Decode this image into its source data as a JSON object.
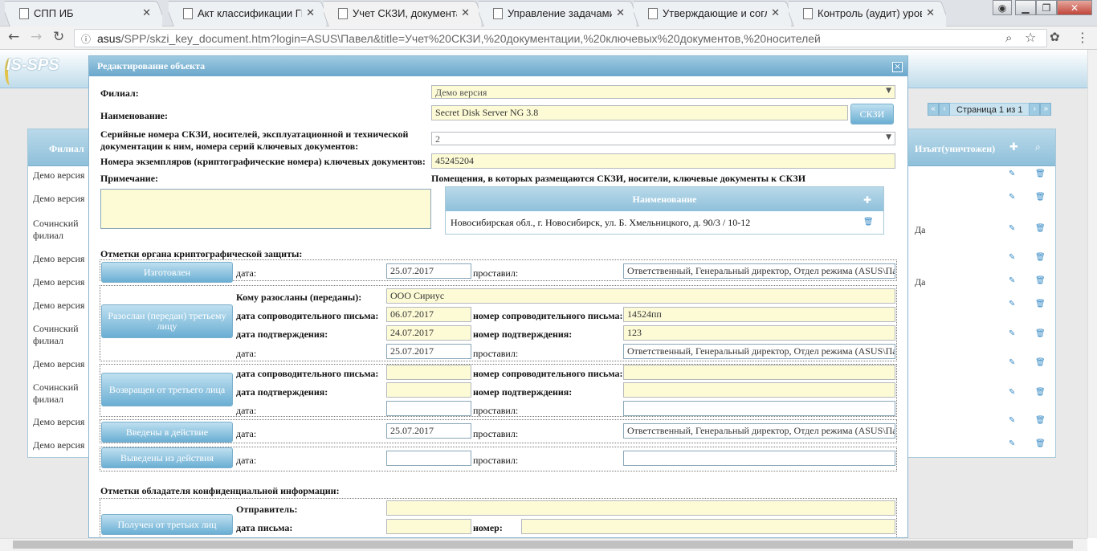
{
  "browser": {
    "tabs": [
      {
        "label": "СПП ИБ",
        "extra": "",
        "active": false
      },
      {
        "label": "Акт классификации ГИС",
        "active": false
      },
      {
        "label": "Учет СКЗИ, документац",
        "active": true
      },
      {
        "label": "Управление задачами",
        "active": false
      },
      {
        "label": "Утверждающие и согла",
        "active": false
      },
      {
        "label": "Контроль (аудит) уровн",
        "active": false
      }
    ],
    "url_host": "asus",
    "url_rest": "/SPP/skzi_key_document.htm?login=ASUS\\Павел&title=Учет%20СКЗИ,%20документации,%20ключевых%20документов,%20носителей"
  },
  "app": {
    "logo": "IS-SPS",
    "pager_label": "Страница 1 из 1",
    "grid_header_left": "Филиал",
    "grid_header_right": "Изъят(уничтожен)",
    "grid_rows": [
      {
        "branch": "Демо версия",
        "flag": ""
      },
      {
        "branch": "Демо версия",
        "flag": ""
      },
      {
        "branch": "Сочинский филиал",
        "flag": "Да"
      },
      {
        "branch": "Демо версия",
        "flag": ""
      },
      {
        "branch": "Демо версия",
        "flag": "Да"
      },
      {
        "branch": "Демо версия",
        "flag": ""
      },
      {
        "branch": "Сочинский филиал",
        "flag": ""
      },
      {
        "branch": "Демо версия",
        "flag": ""
      },
      {
        "branch": "Сочинский филиал",
        "flag": ""
      },
      {
        "branch": "Демо версия",
        "flag": ""
      },
      {
        "branch": "Демо версия",
        "flag": ""
      }
    ]
  },
  "dialog": {
    "title": "Редактирование объекта",
    "branch_label": "Филиал:",
    "branch_value": "Демо версия",
    "name_label": "Наименование:",
    "name_value": "Secret Disk Server NG 3.8",
    "skzi_button": "СКЗИ",
    "serial_label_1": "Серийные номера СКЗИ, носителей, эксплуатационной и технической",
    "serial_label_2": "документации к ним, номера серий ключевых документов:",
    "serial_value": "2",
    "copies_label": "Номера экземпляров (криптографические номера) ключевых документов:",
    "copies_value": "45245204",
    "note_label": "Примечание:",
    "rooms_label": "Помещения, в которых размещаются СКЗИ, носители, ключевые документы к СКЗИ",
    "rooms_header": "Наименование",
    "rooms_item": "Новосибирская обл., г. Новосибирск, ул. Б. Хмельницкого, д. 90/3 / 10-12",
    "crypto_section_label": "Отметки органа криптографической защиты:",
    "owner_section_label": "Отметки обладателя конфиденциальной информации:",
    "lbl_date": "дата:",
    "lbl_set_by": "проставил:",
    "lbl_sent_to": "Кому разосланы (переданы):",
    "lbl_cover_date": "дата сопроводительного письма:",
    "lbl_cover_num": "номер сопроводительного письма:",
    "lbl_confirm_date": "дата подтверждения:",
    "lbl_confirm_num": "номер подтверждения:",
    "lbl_sender": "Отправитель:",
    "lbl_letter_date": "дата письма:",
    "lbl_number": "номер:",
    "responsible": "Ответственный, Генеральный директор, Отдел режима (ASUS\\Па",
    "btn_made": "Изготовлен",
    "made_date": "25.07.2017",
    "btn_sent": "Разослан (передан) третьему лицу",
    "sent_to": "ООО Сириус",
    "sent_cover_date": "06.07.2017",
    "sent_cover_num": "14524пп",
    "sent_confirm_date": "24.07.2017",
    "sent_confirm_num": "123",
    "sent_date": "25.07.2017",
    "btn_returned": "Возвращен от третьего лица",
    "btn_enacted": "Введены в действие",
    "enacted_date": "25.07.2017",
    "btn_removed": "Выведены из действия",
    "btn_received": "Получен от третьих лиц"
  }
}
